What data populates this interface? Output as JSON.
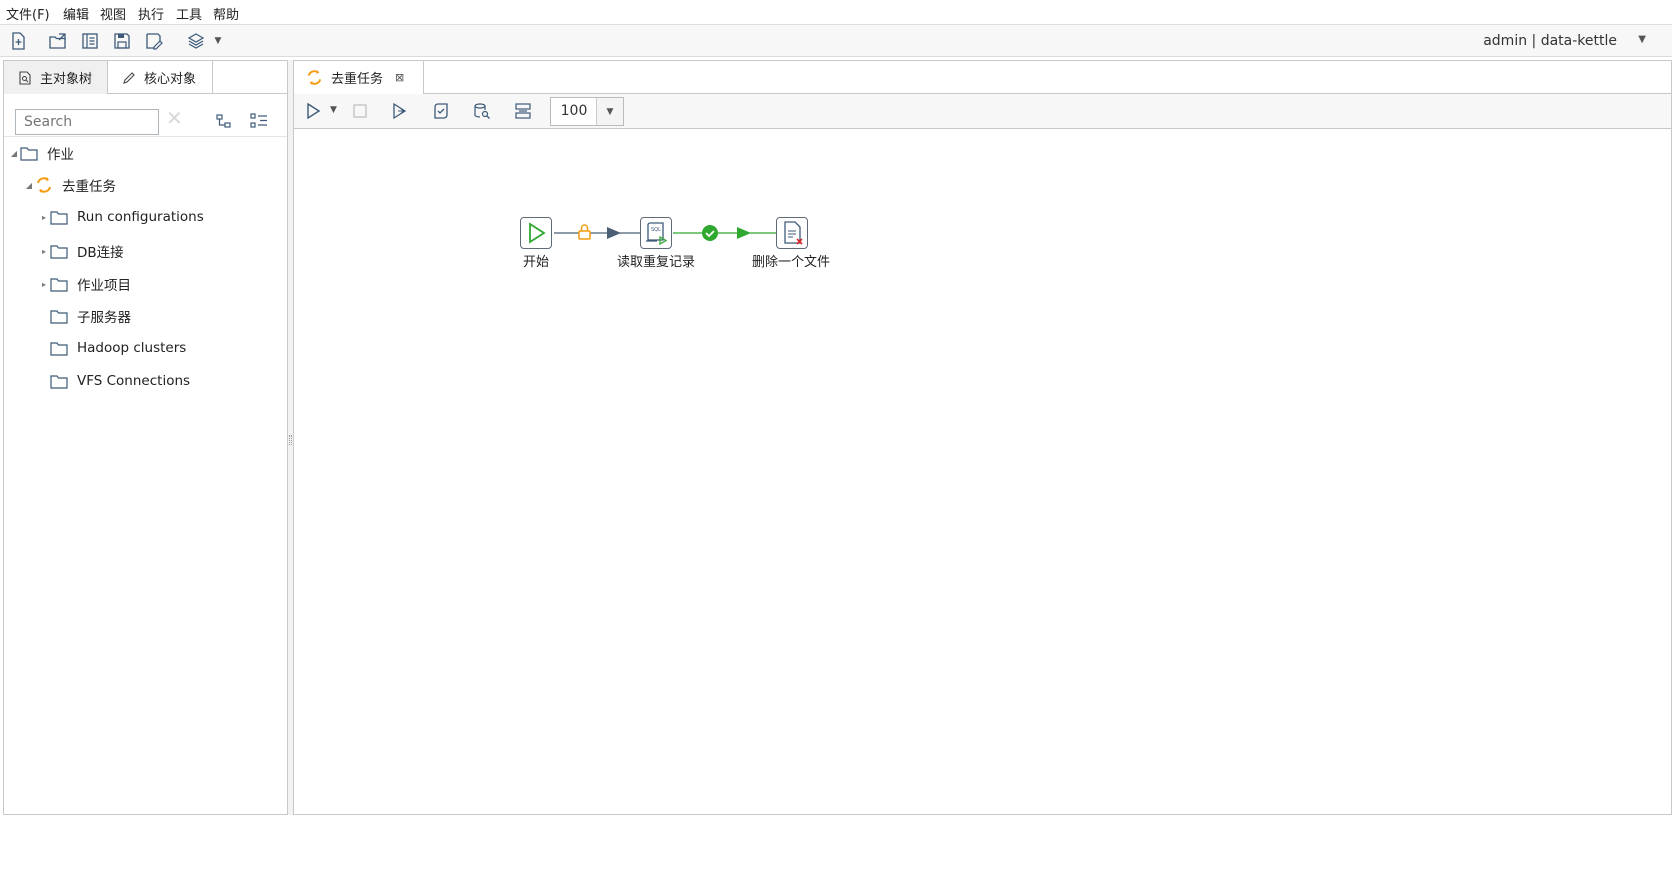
{
  "menu": [
    "文件(F)",
    "编辑",
    "视图",
    "执行",
    "工具",
    "帮助"
  ],
  "toolbar": {
    "icons": [
      "new-file-icon",
      "open-icon",
      "explore-repository-icon",
      "save-icon",
      "save-as-icon",
      "perspective-layers-icon"
    ],
    "user": "admin  |  data-kettle"
  },
  "left_panel": {
    "tabs": [
      "主对象树",
      "核心对象"
    ],
    "search_placeholder": "Search",
    "tree": {
      "root": "作业",
      "job": "去重任务",
      "children": [
        "Run configurations",
        "DB连接",
        "作业项目",
        "子服务器",
        "Hadoop clusters",
        "VFS Connections"
      ]
    }
  },
  "right_panel": {
    "tab_title": "去重任务",
    "zoom": "100",
    "nodes": [
      "开始",
      "读取重复记录",
      "删除一个文件"
    ]
  },
  "colors": {
    "accent_orange": "#f39c12",
    "hop_green": "#2fa82f",
    "hop_dark": "#4a5f73"
  }
}
